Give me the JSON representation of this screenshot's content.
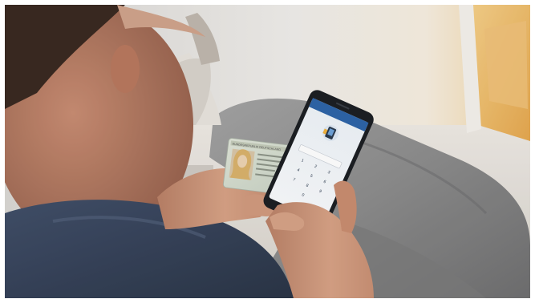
{
  "photo": {
    "subject": "",
    "id_card": {
      "header_text": "BUNDESREPUBLIK DEUTSCHLAND"
    },
    "phone_screen": {
      "app_title": "",
      "prompt_text": "",
      "keypad_keys": [
        "1",
        "2",
        "3",
        "4",
        "5",
        "6",
        "7",
        "8",
        "9",
        "0"
      ]
    }
  }
}
